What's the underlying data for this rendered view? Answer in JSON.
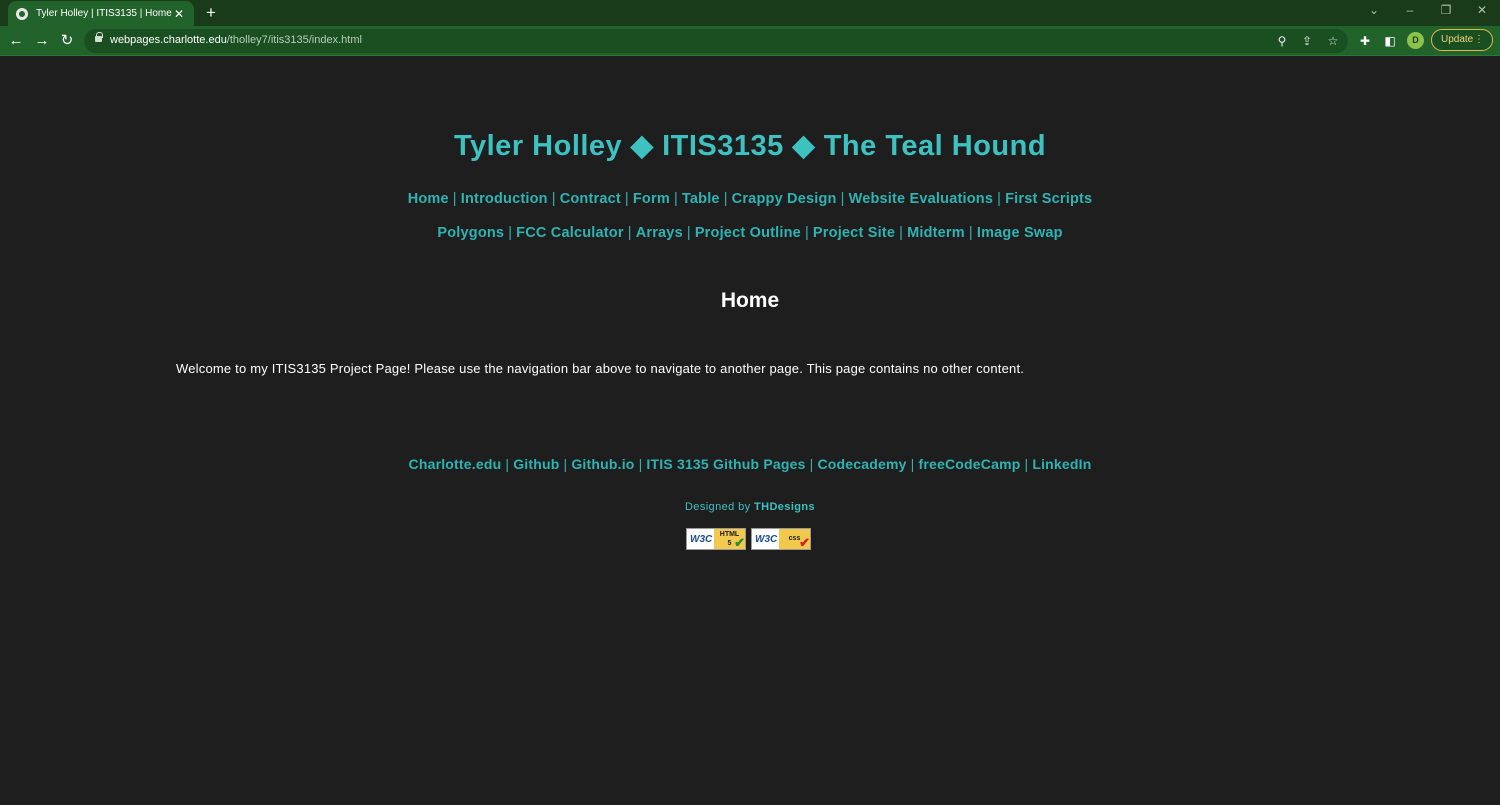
{
  "browser": {
    "tab_title": "Tyler Holley | ITIS3135 | Home",
    "url_host": "webpages.charlotte.edu",
    "url_path": "/tholley7/itis3135/index.html",
    "profile_initial": "D",
    "update_label": "Update"
  },
  "site": {
    "title": "Tyler Holley ◆ ITIS3135 ◆ The Teal Hound",
    "nav_row1": [
      "Home",
      "Introduction",
      "Contract",
      "Form",
      "Table",
      "Crappy Design",
      "Website Evaluations",
      "First Scripts"
    ],
    "nav_row2": [
      "Polygons",
      "FCC Calculator",
      "Arrays",
      "Project Outline",
      "Project Site",
      "Midterm",
      "Image Swap"
    ],
    "separator": "|"
  },
  "main": {
    "heading": "Home",
    "welcome": "Welcome to my ITIS3135 Project Page! Please use the navigation bar above to navigate to another page. This page contains no other content."
  },
  "footer": {
    "links": [
      "Charlotte.edu",
      "Github",
      "Github.io",
      "ITIS 3135 Github Pages",
      "Codecademy",
      "freeCodeCamp",
      "LinkedIn"
    ],
    "designed_prefix": "Designed by",
    "designed_brand": "THDesigns",
    "badges": [
      {
        "w3c": "W3C",
        "label_top": "HTML",
        "label_bottom": "5"
      },
      {
        "w3c": "W3C",
        "label_top": "css",
        "label_bottom": ""
      }
    ]
  },
  "colors": {
    "accent": "#2fb3b3",
    "page_bg": "#1e1e1e",
    "chrome_bg": "#21632a"
  }
}
